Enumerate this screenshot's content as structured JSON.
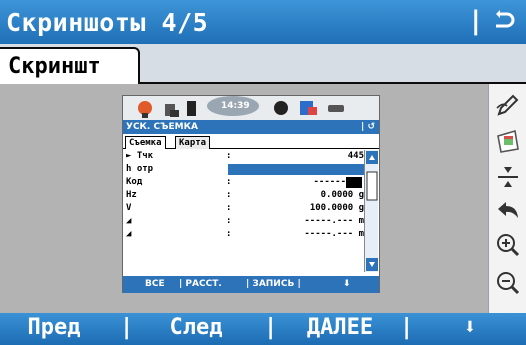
{
  "header": {
    "title": "Скриншоты 4/5",
    "separator": "|"
  },
  "tabs": [
    {
      "label": "Скриншт"
    }
  ],
  "sidebar": {
    "icons": [
      "pen-icon",
      "image-icon",
      "fit-icon",
      "undo-icon",
      "zoom-in-icon",
      "zoom-out-icon"
    ]
  },
  "screenshot": {
    "status_time": "14:39",
    "title": "УСК. СЪЕМКА",
    "title_right": "| ↺",
    "tabs": [
      "Съемка",
      "Карта"
    ],
    "rows": [
      {
        "label": "► Тчк",
        "value": "445"
      },
      {
        "label": "h отр",
        "value": ""
      },
      {
        "label": "Код",
        "value": "------"
      },
      {
        "label": "Hz",
        "value": "0.0000 g"
      },
      {
        "label": "V",
        "value": "100.0000 g"
      },
      {
        "label": "◢",
        "value": "-----.--- m"
      },
      {
        "label": "◢",
        "value": "-----.--- m"
      }
    ],
    "softkeys": [
      "ВСЕ",
      "| РАССТ.",
      "| ЗАПИСЬ |",
      "⬇"
    ]
  },
  "softkeys": {
    "prev": "Пред",
    "next": "След",
    "continue": "ДАЛЕЕ",
    "down": "⬇",
    "separator": "|"
  },
  "colors": {
    "accent": "#2a7bc6",
    "content_bg": "#b3b3b3"
  }
}
